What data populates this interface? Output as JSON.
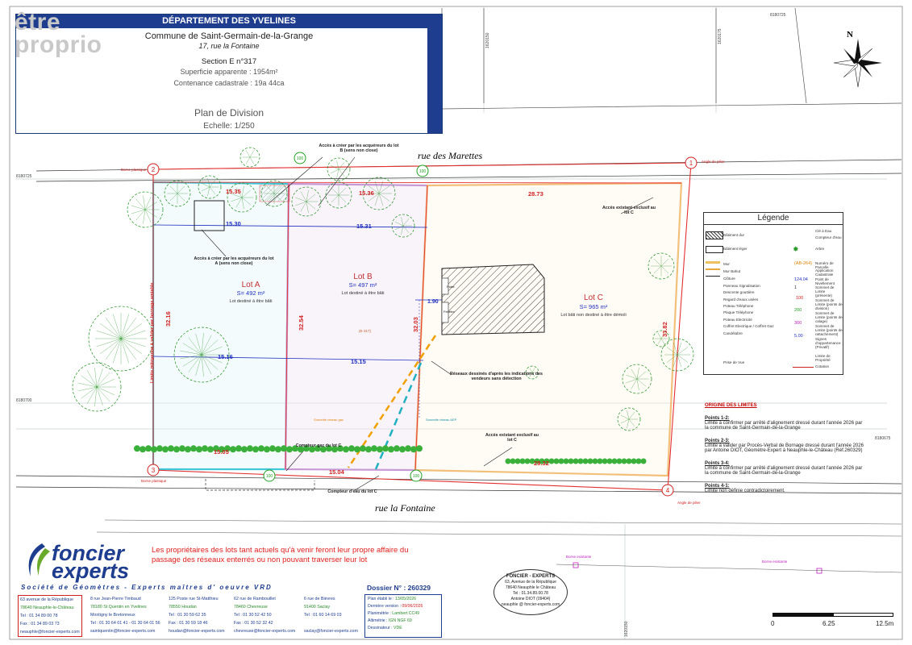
{
  "header": {
    "department": "DÉPARTEMENT DES YVELINES",
    "commune": "Commune de Saint-Germain-de-la-Grange",
    "address": "17, rue la Fontaine",
    "section": "Section E n°317",
    "superficie": "Superficie apparente : 1954m²",
    "contenance": "Contenance cadastrale : 19a 44ca",
    "plan_title": "Plan de Division",
    "scale_text": "Echelle: 1/250"
  },
  "watermark": {
    "line1": "être",
    "line2": "proprio"
  },
  "streets": {
    "north": "rue des Marettes",
    "south": "rue la Fontaine"
  },
  "lots": [
    {
      "name": "Lot A",
      "area": "S= 492 m²",
      "desc": "Lot destiné à être bâti"
    },
    {
      "name": "Lot B",
      "area": "S= 497 m²",
      "desc": "Lot destiné à être bâti"
    },
    {
      "name": "Lot C",
      "area": "S= 965 m²",
      "desc": "Lot bâti non destiné à être démoli"
    }
  ],
  "dimensions": {
    "top_a": "15.35",
    "top_a2": "15.30",
    "top_b": "15.36",
    "top_b2": "15.31",
    "top_c": "28.73",
    "mid_a": "15.16",
    "mid_b": "15.15",
    "bottom_a": "15.05",
    "bottom_b": "15.04",
    "bottom_c": "29.32",
    "left_a": "32.16",
    "ab": "32.54",
    "bc": "32.03",
    "right_c": "33.82",
    "gap": "1.90"
  },
  "points": [
    "1",
    "2",
    "3",
    "4",
    "100",
    "100",
    "100",
    "100"
  ],
  "point_labels": {
    "p1": "Angle de pilier",
    "p2": "Borne plastique",
    "p3": "Borne plastique",
    "p4": "Angle de pilier"
  },
  "annotations": {
    "acces_b": "Accès à créer par les acquéreurs du lot B (sens non close)",
    "acces_a": "Accès à créer par les acquéreurs du lot A (sens non close)",
    "acces_c_top": "Accès existant exclusif au lot C",
    "acces_c_bottom": "Accès existant exclusif au lot C",
    "reseaux": "Réseaux dessinés d'après les indications des vendeurs sans détection",
    "compteur_gaz": "Compteur gaz du lot C",
    "compteur_eau": "Compteur d'eau du lot C",
    "limite_left": "Limite mitoyenne à valider par bornage amiable",
    "gas_line": "Sonnette réseau gaz",
    "water_line": "Sonnette réseau AEP",
    "porte": "Porte",
    "fenetre": "Fenêtre",
    "section_no": "(E-317)"
  },
  "coords": {
    "c1": "8180725",
    "c2": "8180700",
    "c3": "8180675",
    "c4": "1620150",
    "c5": "1620175"
  },
  "north_label": "N",
  "legend": {
    "title": "Légende",
    "left": [
      "Bâtiment dur",
      "Bâtiment léger",
      "Mur",
      "Mur Bahut",
      "Clôture",
      "Panneau Signalisation",
      "Descente gouttière",
      "Regard d'eaux usées",
      "Poteau Téléphone",
      "Plaque Téléphone",
      "Poteau Electricité",
      "Coffret Electrique / Coffret Gaz",
      "Candélabre",
      "Prise de Vue"
    ],
    "right": [
      "Clé à Eau",
      "Compteur d'eau",
      "Arbre",
      "Numéro de Parcelle",
      "Application Cadastrale",
      "Point de Nivellement",
      "Sommet de Limite (présente)",
      "Sommet de Limite (points de division)",
      "Sommet de Limite (points de calage)",
      "Sommet de Limite (points de rattachement)",
      "Signes d'appartenance (Privatif)",
      "Limite de Propriété",
      "Cotation"
    ],
    "samples": [
      "(AB-264)",
      "124.04",
      "1",
      "100",
      "200",
      "300",
      "5.00"
    ]
  },
  "origine": {
    "title": "ORIGINE DES LIMITES",
    "items": [
      {
        "head": "Points 1-2:",
        "text": "Limite à confirmer par arrêté d'alignement dressé durant l'année 2026 par la commune de Saint-Germain-de-la-Grange"
      },
      {
        "head": "Points 2-3:",
        "text": "Limite à valider par Procès-Verbal de Bornage dressé durant l'année 2026 par Antoine DIOT, Géomètre-Expert à Neauphle-le-Château (Réf.260329)"
      },
      {
        "head": "Points 3-4:",
        "text": "Limite à confirmer par arrêté d'alignement dressé durant l'année 2026 par la commune de Saint-Germain-de-la-Grange"
      },
      {
        "head": "Points 4-1:",
        "text": "Limite non définie contradictoirement."
      }
    ]
  },
  "footer": {
    "warning": "Les propriétaires des lots tant actuels qu'à venir feront leur propre affaire du passage des réseaux enterrés ou non pouvant traverser leur lot",
    "brand1": "foncier",
    "brand2": "experts",
    "societe": "Société de Géomètres - Experts    maîtres d' oeuvre VRD",
    "dossier": "Dossier N° : 260329",
    "offices": [
      [
        "63 avenue de la République",
        "78640 Neauphle-le-Château",
        "Tel : 01 34 89 00 78",
        "Fax : 01 34 89 03 73",
        "neauphle@foncier-experts.com"
      ],
      [
        "8 rue Jean-Pierre Timbaud",
        "78180 St Quentin en Yvelines",
        "Montigny le Bretonneux",
        "Tel : 01 30 64 01 41 - 01 30 64 01 56",
        "saintquentin@foncier-experts.com"
      ],
      [
        "125 Poste rue St-Matthieu",
        "78550 Houdan",
        "Tel : 01 30 59 62 35",
        "Fax : 01 30 59 18 46",
        "houdan@foncier-experts.com"
      ],
      [
        "62 rue de Rambouillet",
        "78460 Chevreuse",
        "Tel : 01 30 52 42 50",
        "Fax : 01 30 52 32 42",
        "chevreuse@foncier-experts.com"
      ],
      [
        "6 rue de Bièvres",
        "91400 Saclay",
        "Tel : 01 60 14 69 03",
        "",
        "saclay@foncier-experts.com"
      ]
    ],
    "planinfo": [
      "Plan établi le : 13/05/2026",
      "Dernière version : 09/06/2026",
      "Planimétrie : Lambert CC49",
      "Altimétrie : IGN NGF 69",
      "Dessinateur : VDE"
    ],
    "stamp": [
      "FONCIER - EXPERTS",
      "63, Avenue de la République",
      "78640 Neauphle le Château",
      "Tel : 01.34.89.00.78",
      "Antoine DIOT (09404)",
      "neauphle @ foncier-experts.com"
    ]
  },
  "scalebar": {
    "labels": [
      "0",
      "6.25",
      "12.5m"
    ]
  },
  "bornes": [
    "Borne existante",
    "Borne existante"
  ]
}
